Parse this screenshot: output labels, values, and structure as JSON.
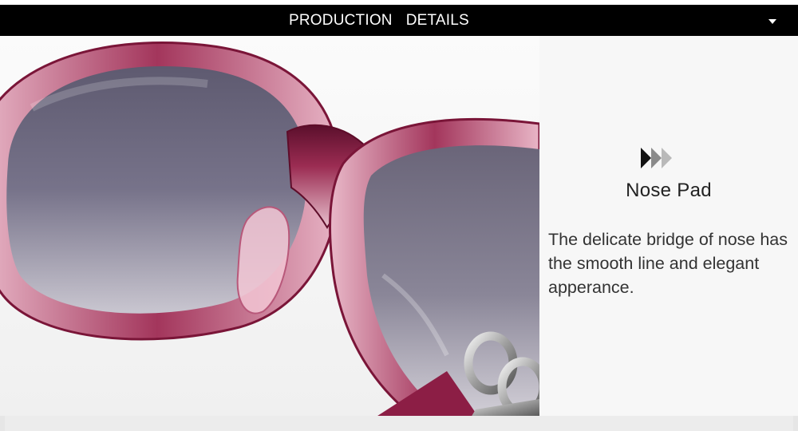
{
  "header": {
    "title_part1": "PRODUCTION",
    "title_part2": "DETAILS",
    "dropdown_icon": "caret-down-icon"
  },
  "feature": {
    "icon": "triple-arrow-right-icon",
    "title": "Nose Pad",
    "description": "The delicate bridge of nose has the smooth line and elegant apperance."
  },
  "colors": {
    "header_bg": "#000000",
    "frame": "#8a1f45",
    "lens": "#6f6b80",
    "panel_bg": "#f7f7f7"
  }
}
